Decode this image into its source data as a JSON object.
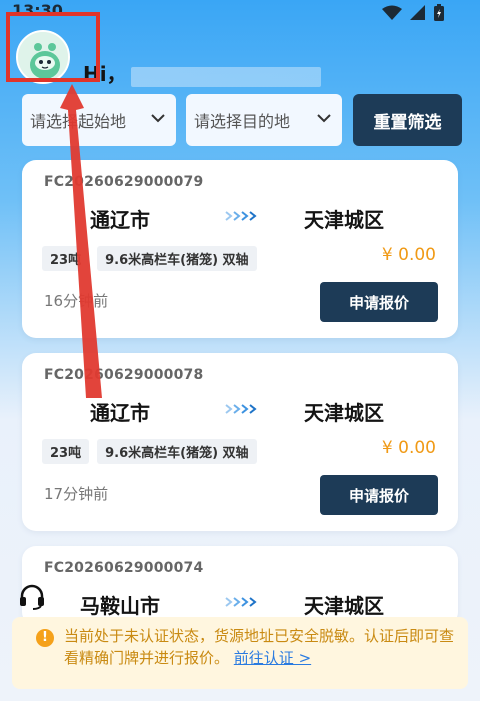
{
  "status_bar": {
    "time": "13:30"
  },
  "header": {
    "greeting": "Hi，"
  },
  "filters": {
    "origin_placeholder": "请选择起始地",
    "destination_placeholder": "请选择目的地",
    "reset_label": "重置筛选"
  },
  "cards": [
    {
      "order_no": "FC20260629000079",
      "from": "通辽市",
      "to": "天津城区",
      "weight": "23吨",
      "vehicle": "9.6米高栏车(猪笼) 双轴",
      "price": "¥ 0.00",
      "time_ago": "16分钟前",
      "action": "申请报价"
    },
    {
      "order_no": "FC20260629000078",
      "from": "通辽市",
      "to": "天津城区",
      "weight": "23吨",
      "vehicle": "9.6米高栏车(猪笼) 双轴",
      "price": "¥ 0.00",
      "time_ago": "17分钟前",
      "action": "申请报价"
    },
    {
      "order_no": "FC20260629000074",
      "from": "马鞍山市",
      "to": "天津城区"
    }
  ],
  "support": {
    "label": "客服"
  },
  "notice": {
    "text": "当前处于未认证状态，货源地址已安全脱敏。认证后即可查看精确门牌并进行报价。",
    "link": "前往认证 >"
  },
  "colors": {
    "primary_dark": "#1d3b57",
    "price_orange": "#f09a16",
    "annotation_red": "#e0342a"
  }
}
